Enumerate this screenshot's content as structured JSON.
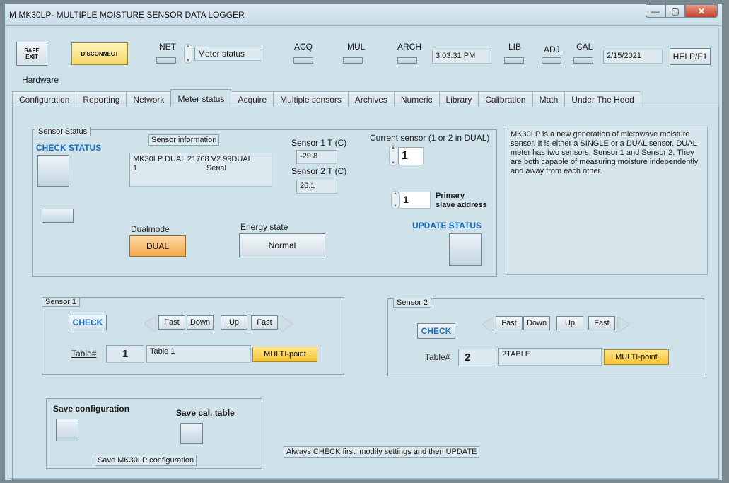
{
  "window": {
    "title": "M  MK30LP- MULTIPLE MOISTURE SENSOR DATA LOGGER",
    "minimize": "—",
    "maximize": "▢",
    "close": "✕"
  },
  "toolbar": {
    "safe_exit": "SAFE\nEXIT",
    "disconnect": "DISCONNECT",
    "net": "NET",
    "meter_status": "Meter status",
    "acq": "ACQ",
    "mul": "MUL",
    "arch": "ARCH",
    "time": "3:03:31 PM",
    "lib": "LIB",
    "adj": "ADJ.",
    "cal": "CAL",
    "date": "2/15/2021",
    "help": "HELP/F1"
  },
  "hardware_label": "Hardware",
  "tabs": [
    "Configuration",
    "Reporting",
    "Network",
    "Meter status",
    "Acquire",
    "Multiple sensors",
    "Archives",
    "Numeric",
    "Library",
    "Calibration",
    "Math",
    "Under The Hood"
  ],
  "active_tab": "Meter status",
  "sensor_status": {
    "group_title": "Sensor Status",
    "check_status": "CHECK STATUS",
    "sensor_info_label": "Sensor information",
    "sensor_info_line1": "MK30LP DUAL 21768   V2.99DUAL",
    "sensor_info_line2": "1",
    "sensor_info_serial": "Serial",
    "sensor1_t_label": "Sensor 1 T (C)",
    "sensor1_t": "-29.8",
    "sensor2_t_label": "Sensor 2 T (C)",
    "sensor2_t": "26.1",
    "current_sensor_label": "Current sensor (1 or 2 in DUAL)",
    "current_sensor": "1",
    "slave_address": "1",
    "primary_label": "Primary",
    "slave_label": "slave address",
    "dualmode_label": "Dualmode",
    "dualmode": "DUAL",
    "energy_label": "Energy state",
    "energy": "Normal",
    "update_status": "UPDATE STATUS"
  },
  "description": "MK30LP is a new generation of microwave moisture sensor. It is either a SINGLE or a DUAL sensor. DUAL meter has two sensors, Sensor 1 and Sensor 2. They are both capable of measuring moisture independently and away from each other.",
  "sensor1": {
    "title": "Sensor 1",
    "check": "CHECK",
    "fast_left": "Fast",
    "down": "Down",
    "up": "Up",
    "fast_right": "Fast",
    "table_label": "Table#",
    "table_num": "1",
    "table_name": "Table 1",
    "multipoint": "MULTI-point"
  },
  "sensor2": {
    "title": "Sensor 2",
    "check": "CHECK",
    "fast_left": "Fast",
    "down": "Down",
    "up": "Up",
    "fast_right": "Fast",
    "table_label": "Table#",
    "table_num": "2",
    "table_name": "2TABLE",
    "multipoint": "MULTI-point"
  },
  "save": {
    "save_configuration": "Save configuration",
    "save_cal_table": "Save cal. table",
    "save_mk30lp_config": "Save MK30LP configuration"
  },
  "footer_hint": "Always CHECK first, modify settings and then UPDATE"
}
